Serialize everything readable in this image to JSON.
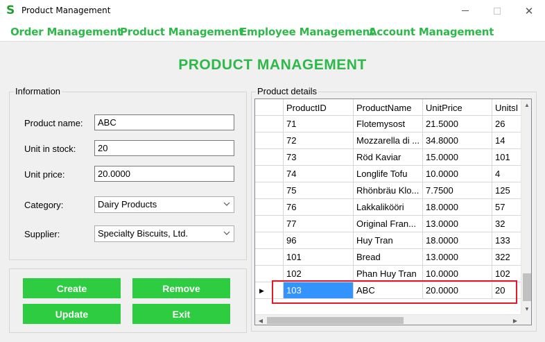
{
  "window": {
    "title": "Product Management",
    "logo": "S",
    "min_icon": "minimize-icon",
    "max_icon": "maximize-icon",
    "close_glyph": "✕"
  },
  "menu": [
    {
      "label": "Order Management"
    },
    {
      "label": "Product Management"
    },
    {
      "label": "Employee Management"
    },
    {
      "label": "Account Management"
    }
  ],
  "heading": "PRODUCT MANAGEMENT",
  "info": {
    "legend": "Information",
    "product_name_label": "Product name:",
    "product_name_value": "ABC",
    "unit_in_stock_label": "Unit in stock:",
    "unit_in_stock_value": "20",
    "unit_price_label": "Unit price:",
    "unit_price_value": "20.0000",
    "category_label": "Category:",
    "category_value": "Dairy Products",
    "supplier_label": "Supplier:",
    "supplier_value": "Specialty Biscuits, Ltd."
  },
  "actions": {
    "create": "Create",
    "remove": "Remove",
    "update": "Update",
    "exit": "Exit"
  },
  "details": {
    "legend": "Product details",
    "columns": [
      "ProductID",
      "ProductName",
      "UnitPrice",
      "UnitsI"
    ],
    "rows": [
      [
        "71",
        "Flotemysost",
        "21.5000",
        "26"
      ],
      [
        "72",
        "Mozzarella di ...",
        "34.8000",
        "14"
      ],
      [
        "73",
        "Röd Kaviar",
        "15.0000",
        "101"
      ],
      [
        "74",
        "Longlife Tofu",
        "10.0000",
        "4"
      ],
      [
        "75",
        "Rhönbräu Klo...",
        "7.7500",
        "125"
      ],
      [
        "76",
        "Lakkalikööri",
        "18.0000",
        "57"
      ],
      [
        "77",
        "Original Fran...",
        "13.0000",
        "32"
      ],
      [
        "96",
        "Huy Tran",
        "18.0000",
        "133"
      ],
      [
        "101",
        "Bread",
        "13.0000",
        "322"
      ],
      [
        "102",
        "Phan Huy Tran",
        "10.0000",
        "102"
      ],
      [
        "103",
        "ABC",
        "20.0000",
        "20"
      ]
    ],
    "current_row_marker": "▶"
  },
  "colors": {
    "accent": "#2fb84a",
    "button": "#2ecc40",
    "selection": "#3393ff",
    "highlight": "#e01a2a"
  }
}
